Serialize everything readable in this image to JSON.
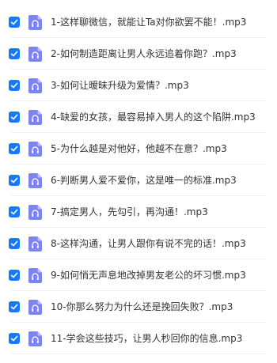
{
  "colors": {
    "checkbox_fill": "#1677ff",
    "file_icon_fill": "#7b84f2",
    "text": "#333333"
  },
  "file_list": {
    "items": [
      {
        "name": "1-这样聊微信，就能让Ta对你欲罢不能！.mp3",
        "checked": true,
        "icon": "audio-file-icon"
      },
      {
        "name": "2-如何制造距离让男人永远追着你跑？.mp3",
        "checked": true,
        "icon": "audio-file-icon"
      },
      {
        "name": "3-如何让暧昧升级为爱情？.mp3",
        "checked": true,
        "icon": "audio-file-icon"
      },
      {
        "name": "4-缺爱的女孩，最容易掉入男人的这个陷阱.mp3",
        "checked": true,
        "icon": "audio-file-icon"
      },
      {
        "name": "5-为什么越是对他好，他越不在意？.mp3",
        "checked": true,
        "icon": "audio-file-icon"
      },
      {
        "name": "6-判断男人爱不爱你，这是唯一的标准.mp3",
        "checked": true,
        "icon": "audio-file-icon"
      },
      {
        "name": "7-搞定男人，先勾引，再沟通！.mp3",
        "checked": true,
        "icon": "audio-file-icon"
      },
      {
        "name": "8-这样沟通，让男人跟你有说不完的话！.mp3",
        "checked": true,
        "icon": "audio-file-icon"
      },
      {
        "name": "9-如何悄无声息地改掉男友老公的坏习惯.mp3",
        "checked": true,
        "icon": "audio-file-icon"
      },
      {
        "name": "10-你那么努力为什么还是挽回失败？.mp3",
        "checked": true,
        "icon": "audio-file-icon"
      },
      {
        "name": "11-学会这些技巧，让男人秒回你的信息.mp3",
        "checked": true,
        "icon": "audio-file-icon"
      }
    ]
  }
}
